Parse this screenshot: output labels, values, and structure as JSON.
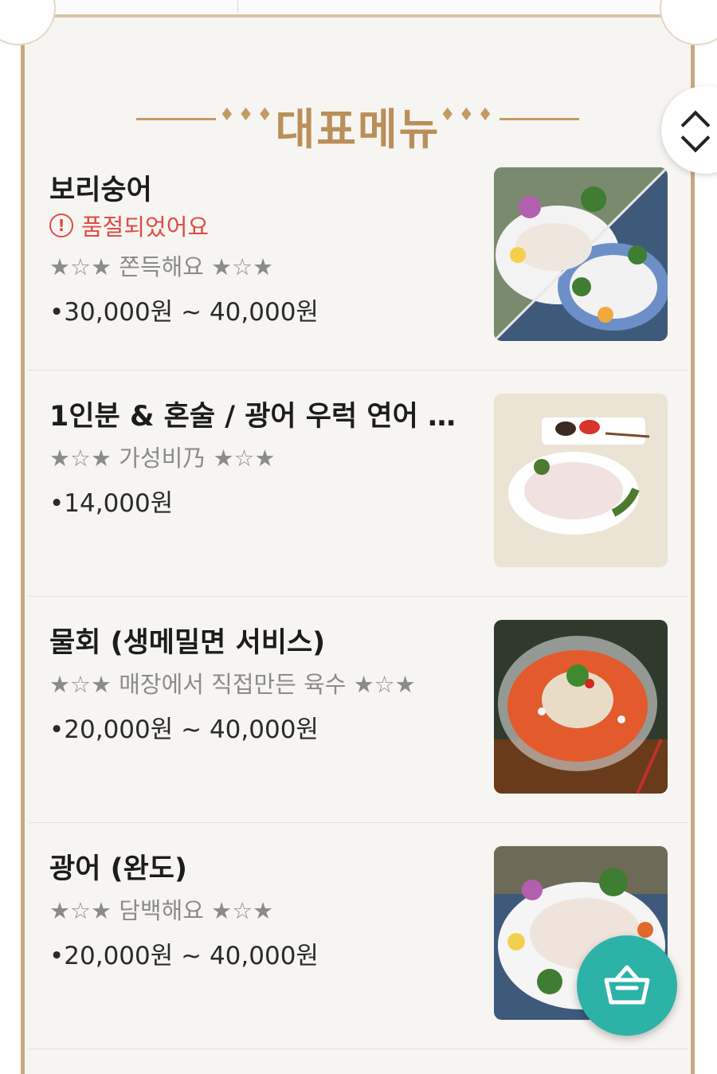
{
  "section": {
    "title": "대표메뉴",
    "ornament_left": "♦♦♦",
    "ornament_right": "♦♦♦"
  },
  "menu": [
    {
      "name": "보리숭어",
      "status": "품절되었어요",
      "description": "★☆★ 쫀득해요 ★☆★",
      "price": "•30,000원 ~ 40,000원",
      "image": "sashimi-platter"
    },
    {
      "name": "1인분 & 혼술 / 광어 우럭 연어 숭...",
      "status": "",
      "description": "★☆★ 가성비乃 ★☆★",
      "price": "•14,000원",
      "image": "single-serving-sashimi"
    },
    {
      "name": "물회 (생메밀면 서비스)",
      "status": "",
      "description": "★☆★ 매장에서 직접만든 육수 ★☆★",
      "price": "•20,000원 ~ 40,000원",
      "image": "mulhoe-bowl"
    },
    {
      "name": "광어 (완도)",
      "status": "",
      "description": "★☆★ 담백해요 ★☆★",
      "price": "•20,000원 ~ 40,000원",
      "image": "flatfish-sashimi"
    }
  ],
  "icons": {
    "alert": "alert-circle-icon",
    "scroll": "scroll-up-down-icon",
    "cart": "shopping-basket-icon"
  },
  "colors": {
    "accent_gold": "#b98f5a",
    "sold_out_red": "#e04b45",
    "cart_teal": "#2db2a8",
    "frame_border": "#c9a97e"
  }
}
